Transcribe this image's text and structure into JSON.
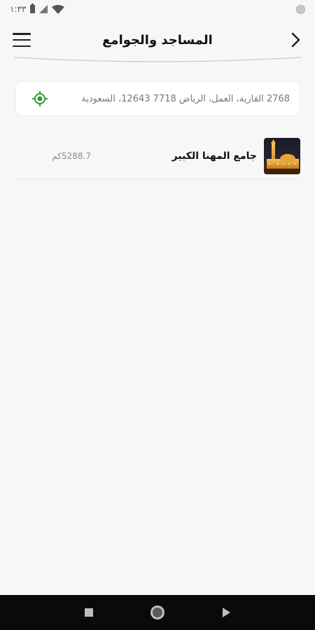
{
  "status_bar": {
    "time": "١:٣٣"
  },
  "header": {
    "title": "المساجد والجوامع"
  },
  "location": {
    "address": "2768 القارية، العمل، الرياض 7718 12643، السعودية"
  },
  "mosques": [
    {
      "name": "جامع المهنا الكبير",
      "distance": "5288.7كم"
    }
  ],
  "colors": {
    "accent": "#2e9b3a",
    "background": "#f7f7f7",
    "nav_bar": "#0a0a0a"
  }
}
